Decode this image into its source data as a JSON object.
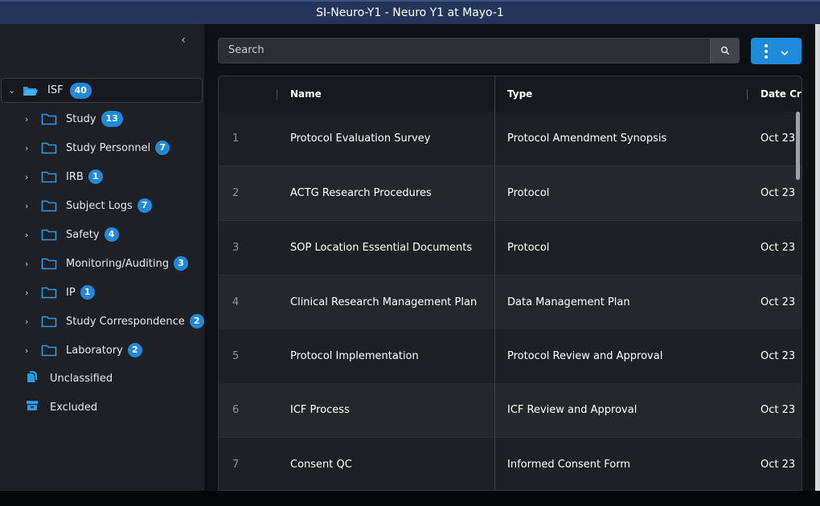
{
  "window": {
    "title": "SI-Neuro-Y1 - Neuro Y1 at Mayo-1"
  },
  "sidebar": {
    "collapse_icon": "chevron-left-icon",
    "root": {
      "label": "ISF",
      "count": "40",
      "icon": "folder-open-icon"
    },
    "items": [
      {
        "label": "Study",
        "count": "13"
      },
      {
        "label": "Study Personnel",
        "count": "7"
      },
      {
        "label": "IRB",
        "count": "1"
      },
      {
        "label": "Subject Logs",
        "count": "7"
      },
      {
        "label": "Safety",
        "count": "4"
      },
      {
        "label": "Monitoring/Auditing",
        "count": "3"
      },
      {
        "label": "IP",
        "count": "1"
      },
      {
        "label": "Study Correspondence",
        "count": "2"
      },
      {
        "label": "Laboratory",
        "count": "2"
      }
    ],
    "special": [
      {
        "label": "Unclassified",
        "icon": "file-stack-icon"
      },
      {
        "label": "Excluded",
        "icon": "archive-box-icon"
      }
    ]
  },
  "search": {
    "placeholder": "Search",
    "icon": "search-icon"
  },
  "actions": {
    "icon": "kebab-menu-icon",
    "caret": "chevron-down-icon",
    "color": "#1e8ad8"
  },
  "table": {
    "columns": [
      "Name",
      "Type",
      "Date Cre"
    ],
    "rows": [
      {
        "num": "1",
        "name": "Protocol Evaluation Survey",
        "type": "Protocol Amendment Synopsis",
        "date": "Oct 23"
      },
      {
        "num": "2",
        "name": "ACTG Research Procedures",
        "type": "Protocol",
        "date": "Oct 23"
      },
      {
        "num": "3",
        "name": "SOP Location Essential Documents",
        "type": "Protocol",
        "date": "Oct 23"
      },
      {
        "num": "4",
        "name": "Clinical Research Management Plan",
        "type": "Data Management Plan",
        "date": "Oct 23"
      },
      {
        "num": "5",
        "name": "Protocol Implementation",
        "type": "Protocol Review and Approval",
        "date": "Oct 23"
      },
      {
        "num": "6",
        "name": "ICF Process",
        "type": "ICF Review and Approval",
        "date": "Oct 23"
      },
      {
        "num": "7",
        "name": "Consent QC",
        "type": "Informed Consent Form",
        "date": "Oct 23"
      }
    ]
  },
  "colors": {
    "accent": "#1f8ad9",
    "titlebar": "#23365a"
  }
}
